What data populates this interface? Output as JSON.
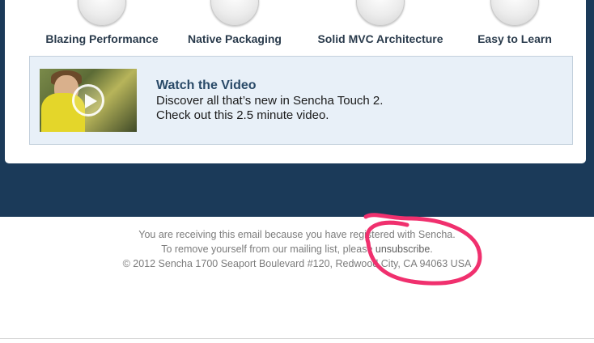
{
  "features": [
    {
      "label": "Blazing Performance",
      "icon": "performance-gauge-icon"
    },
    {
      "label": "Native Packaging",
      "icon": "package-box-icon"
    },
    {
      "label": "Solid MVC Architecture",
      "icon": "mvc-blocks-icon"
    },
    {
      "label": "Easy to Learn",
      "icon": "lightbulb-icon"
    }
  ],
  "video": {
    "title": "Watch the Video",
    "line1": "Discover all that’s new in Sencha Touch 2.",
    "line2": "Check out this 2.5 minute video."
  },
  "footer": {
    "line1": "You are receiving this email because you have registered with Sencha.",
    "line2_prefix": "To remove yourself from our mailing list, please ",
    "unsubscribe": "unsubscribe",
    "line2_suffix": ".",
    "line3": "© 2012 Sencha 1700 Seaport Boulevard #120, Redwood City, CA 94063 USA"
  },
  "colors": {
    "navy": "#1b3a59",
    "annotation": "#f0306e"
  }
}
